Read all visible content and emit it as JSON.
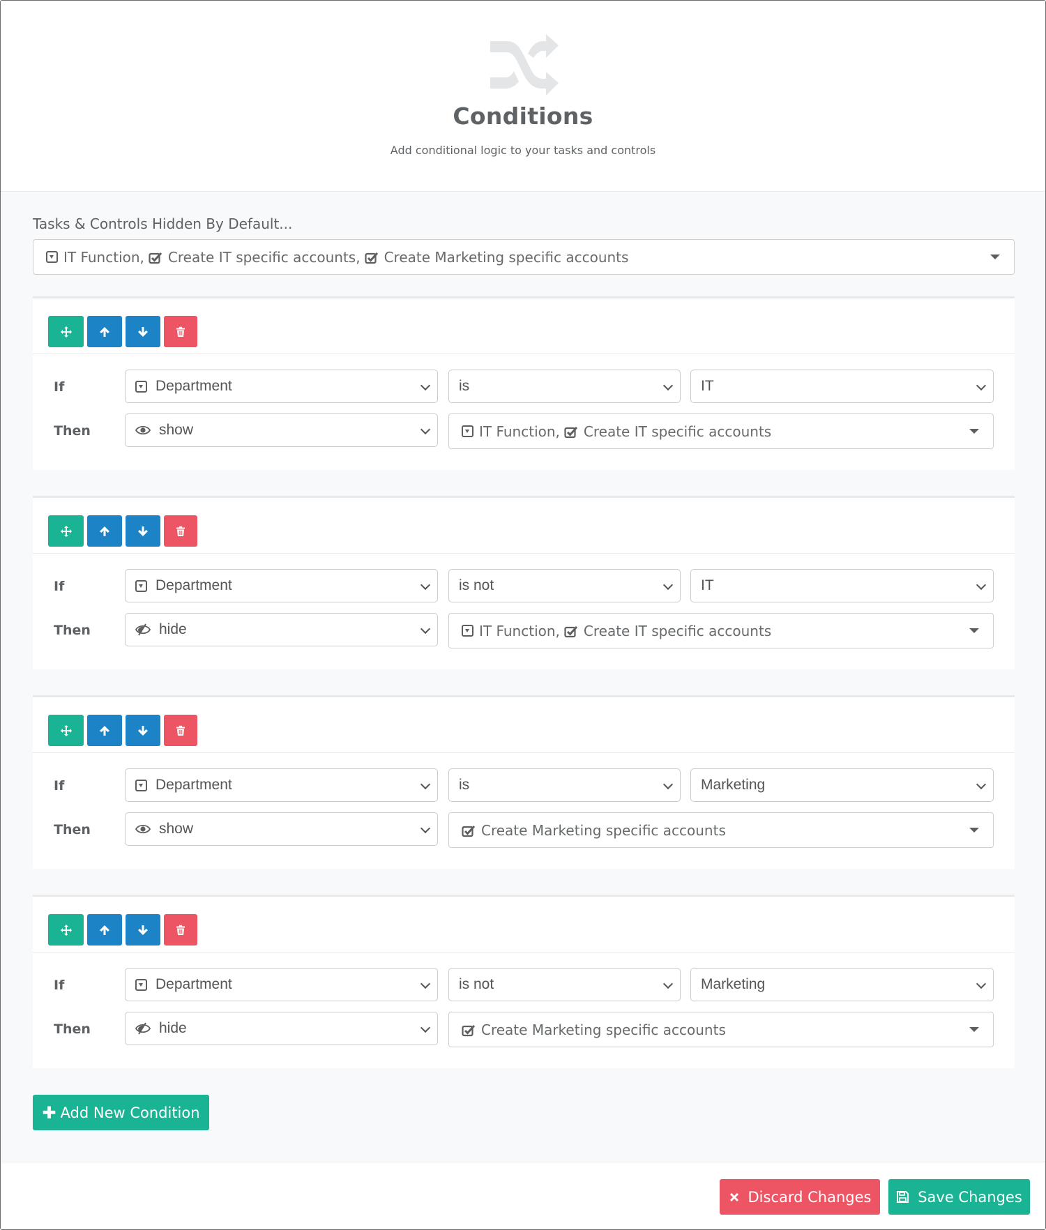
{
  "header": {
    "icon": "random-shuffle-icon",
    "title": "Conditions",
    "subtitle": "Add conditional logic to your tasks and controls"
  },
  "hidden_by_default": {
    "label": "Tasks & Controls Hidden By Default...",
    "items": [
      {
        "icon": "dropdown-field-icon",
        "text": "IT Function,"
      },
      {
        "icon": "checkbox-task-icon",
        "text": "Create IT specific accounts,"
      },
      {
        "icon": "checkbox-task-icon",
        "text": "Create Marketing specific accounts"
      }
    ]
  },
  "labels": {
    "if": "If",
    "then": "Then"
  },
  "conditions": [
    {
      "field": "Department",
      "operator": "is",
      "value": "IT",
      "action": "show",
      "action_icon": "eye-icon",
      "targets": [
        {
          "icon": "dropdown-field-icon",
          "text": "IT Function,"
        },
        {
          "icon": "checkbox-task-icon",
          "text": "Create IT specific accounts"
        }
      ]
    },
    {
      "field": "Department",
      "operator": "is not",
      "value": "IT",
      "action": "hide",
      "action_icon": "eye-slash-icon",
      "targets": [
        {
          "icon": "dropdown-field-icon",
          "text": "IT Function,"
        },
        {
          "icon": "checkbox-task-icon",
          "text": "Create IT specific accounts"
        }
      ]
    },
    {
      "field": "Department",
      "operator": "is",
      "value": "Marketing",
      "action": "show",
      "action_icon": "eye-icon",
      "targets": [
        {
          "icon": "checkbox-task-icon",
          "text": "Create Marketing specific accounts"
        }
      ]
    },
    {
      "field": "Department",
      "operator": "is not",
      "value": "Marketing",
      "action": "hide",
      "action_icon": "eye-slash-icon",
      "targets": [
        {
          "icon": "checkbox-task-icon",
          "text": "Create Marketing specific accounts"
        }
      ]
    }
  ],
  "add_button": "Add New Condition",
  "footer": {
    "discard": "Discard Changes",
    "save": "Save Changes"
  },
  "colors": {
    "green": "#1ab394",
    "blue": "#1c84c6",
    "red": "#ed5565",
    "text": "#676a6c",
    "panel_bg": "#f8f9fb"
  }
}
